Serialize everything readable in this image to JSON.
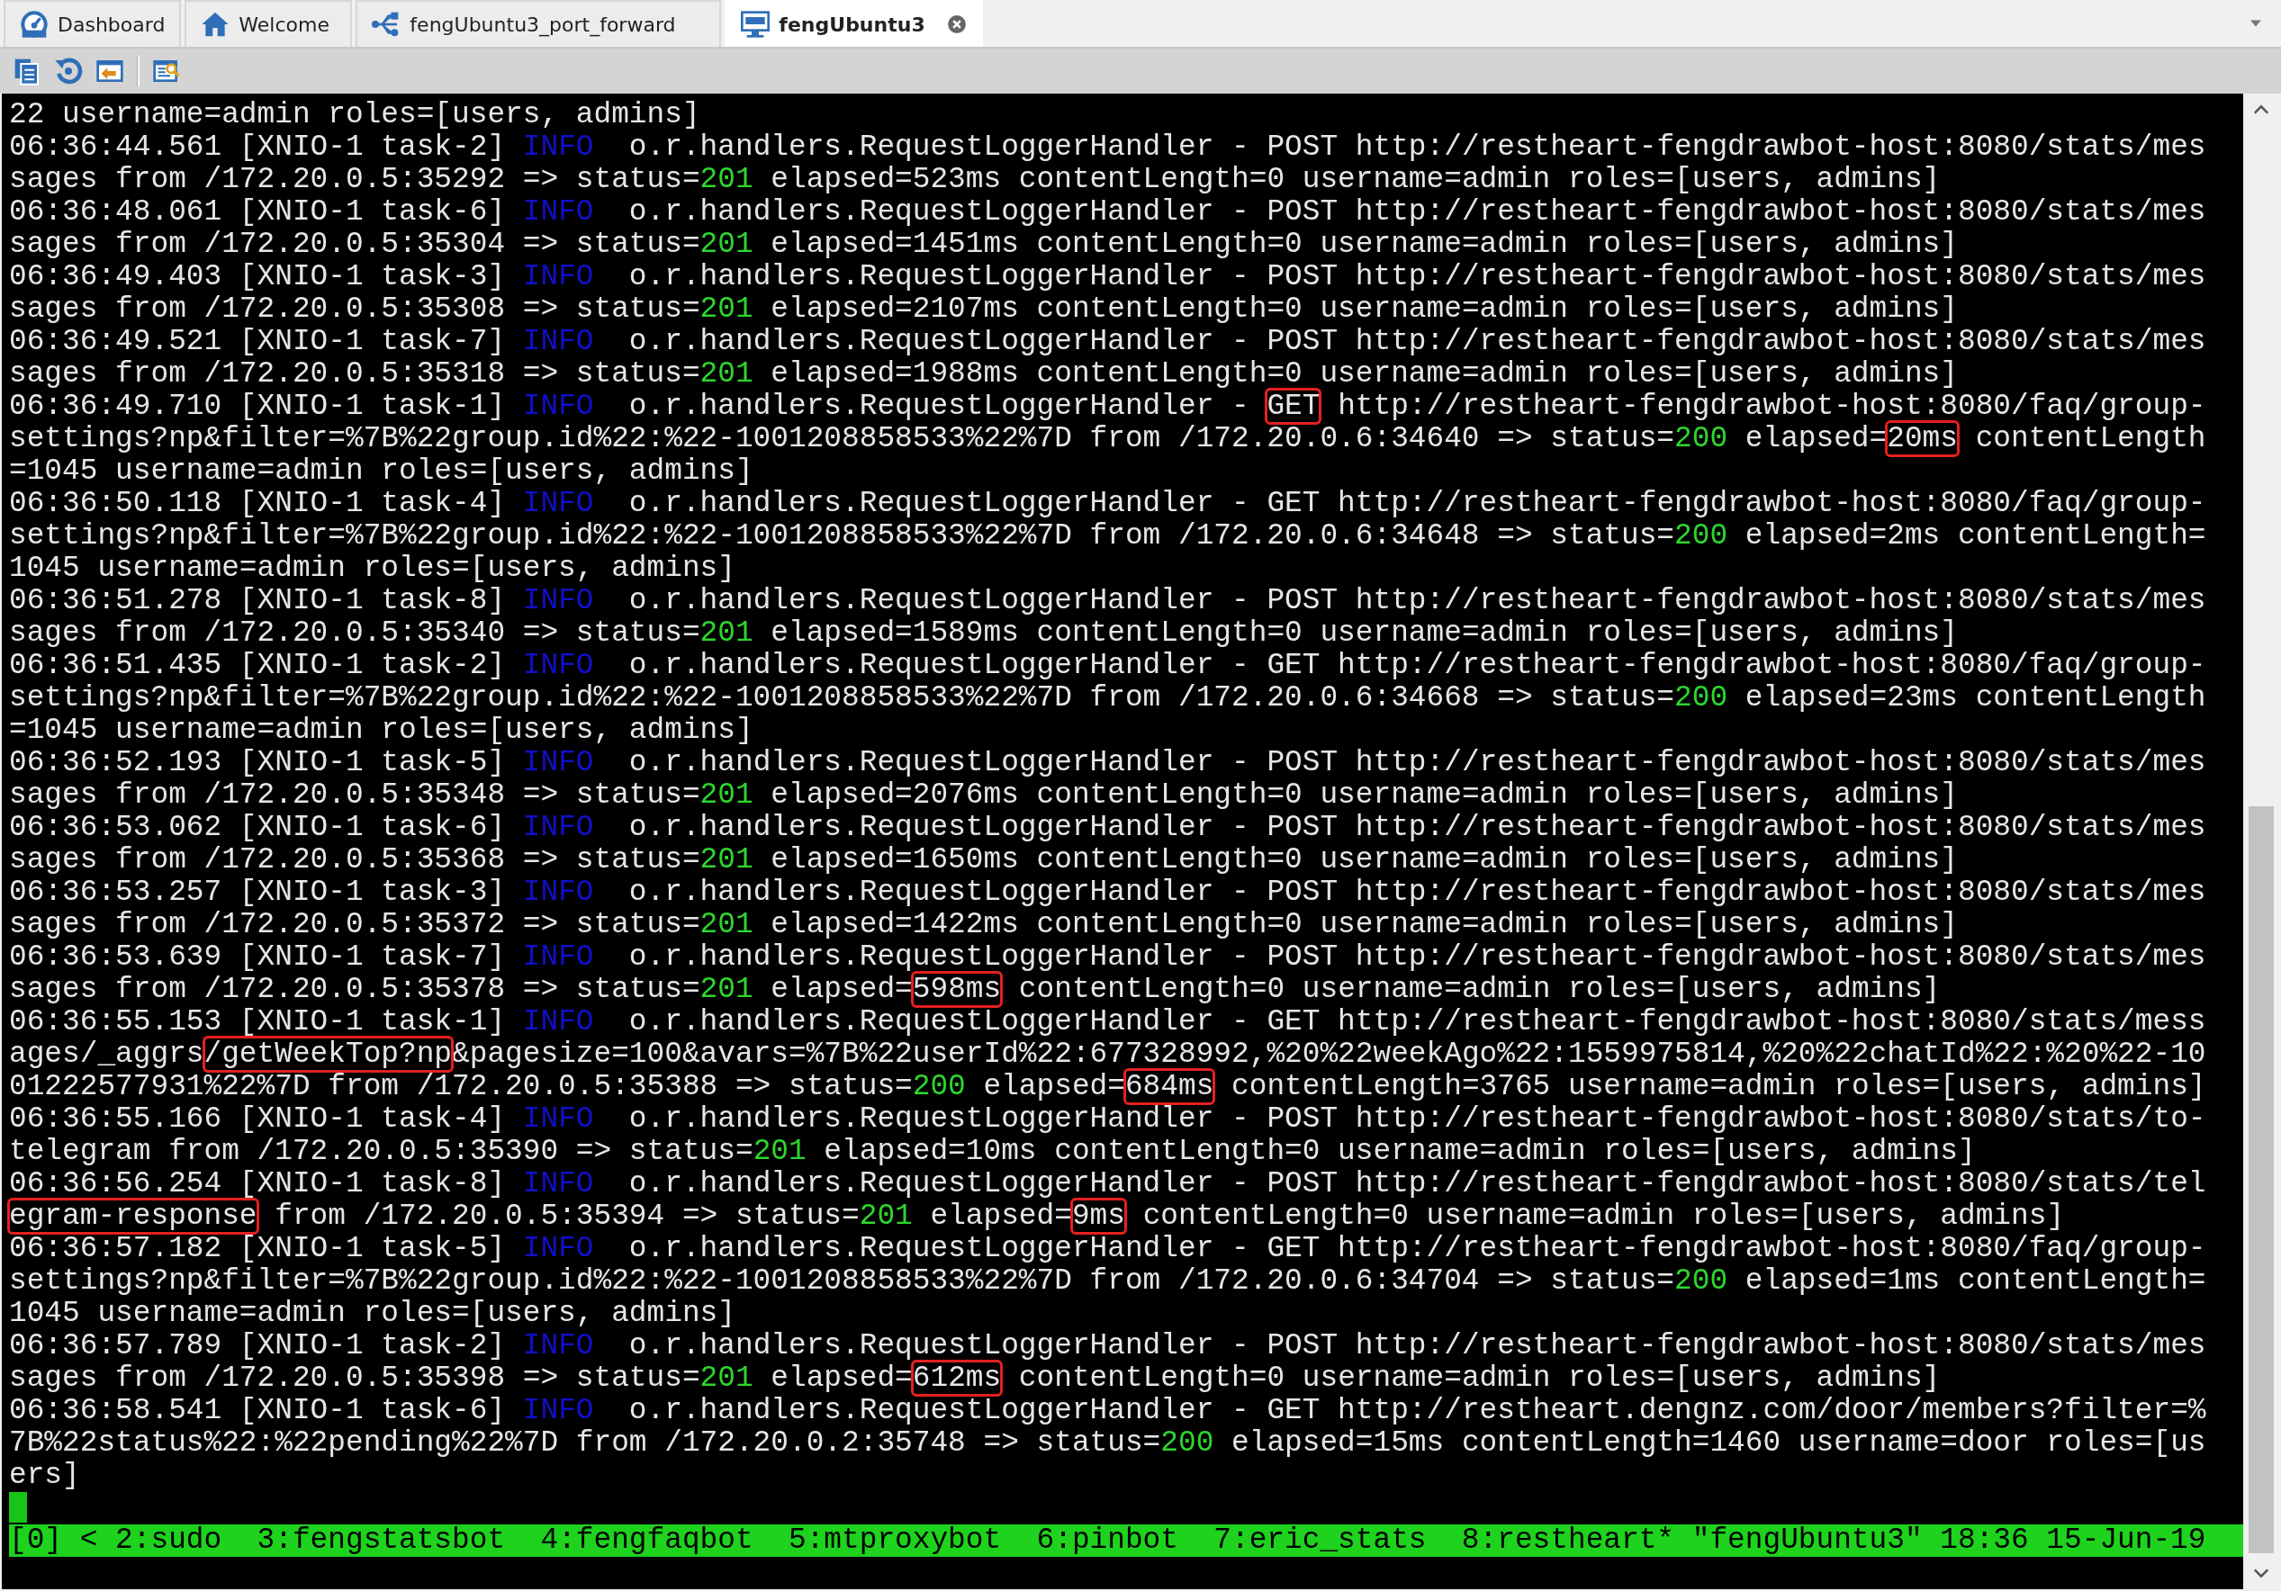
{
  "tabs": [
    {
      "label": "Dashboard",
      "kind": "dashboard",
      "selected": false
    },
    {
      "label": "Welcome",
      "kind": "welcome",
      "selected": false
    },
    {
      "label": "fengUbuntu3_port_forward",
      "kind": "forward",
      "selected": false
    },
    {
      "label": "fengUbuntu3",
      "kind": "ssh",
      "selected": true
    }
  ],
  "terminal": {
    "lines": [
      [
        {
          "text": "22 username=admin roles=[users, admins]",
          "kind": "text"
        }
      ],
      [
        {
          "text": "06:36:44.561 [XNIO-1 task-2] ",
          "kind": "text"
        },
        {
          "text": "INFO",
          "kind": "info"
        },
        {
          "text": "  o.r.handlers.RequestLoggerHandler - POST http://restheart-fengdrawbot-host:8080/stats/mes",
          "kind": "text"
        }
      ],
      [
        {
          "text": "sages from /172.20.0.5:35292 => status=",
          "kind": "text"
        },
        {
          "text": "201",
          "kind": "status"
        },
        {
          "text": " elapsed=523ms contentLength=0 username=admin roles=[users, admins]",
          "kind": "text"
        }
      ],
      [
        {
          "text": "06:36:48.061 [XNIO-1 task-6] ",
          "kind": "text"
        },
        {
          "text": "INFO",
          "kind": "info"
        },
        {
          "text": "  o.r.handlers.RequestLoggerHandler - POST http://restheart-fengdrawbot-host:8080/stats/mes",
          "kind": "text"
        }
      ],
      [
        {
          "text": "sages from /172.20.0.5:35304 => status=",
          "kind": "text"
        },
        {
          "text": "201",
          "kind": "status"
        },
        {
          "text": " elapsed=1451ms contentLength=0 username=admin roles=[users, admins]",
          "kind": "text"
        }
      ],
      [
        {
          "text": "06:36:49.403 [XNIO-1 task-3] ",
          "kind": "text"
        },
        {
          "text": "INFO",
          "kind": "info"
        },
        {
          "text": "  o.r.handlers.RequestLoggerHandler - POST http://restheart-fengdrawbot-host:8080/stats/mes",
          "kind": "text"
        }
      ],
      [
        {
          "text": "sages from /172.20.0.5:35308 => status=",
          "kind": "text"
        },
        {
          "text": "201",
          "kind": "status"
        },
        {
          "text": " elapsed=2107ms contentLength=0 username=admin roles=[users, admins]",
          "kind": "text"
        }
      ],
      [
        {
          "text": "06:36:49.521 [XNIO-1 task-7] ",
          "kind": "text"
        },
        {
          "text": "INFO",
          "kind": "info"
        },
        {
          "text": "  o.r.handlers.RequestLoggerHandler - POST http://restheart-fengdrawbot-host:8080/stats/mes",
          "kind": "text"
        }
      ],
      [
        {
          "text": "sages from /172.20.0.5:35318 => status=",
          "kind": "text"
        },
        {
          "text": "201",
          "kind": "status"
        },
        {
          "text": " elapsed=1988ms contentLength=0 username=admin roles=[users, admins]",
          "kind": "text"
        }
      ],
      [
        {
          "text": "06:36:49.710 [XNIO-1 task-1] ",
          "kind": "text"
        },
        {
          "text": "INFO",
          "kind": "info"
        },
        {
          "text": "  o.r.handlers.RequestLoggerHandler - ",
          "kind": "text"
        },
        {
          "text": "GET",
          "kind": "boxed"
        },
        {
          "text": " http://restheart-fengdrawbot-host:8080/faq/group-",
          "kind": "text"
        }
      ],
      [
        {
          "text": "settings?np&filter=%7B%22group.id%22:%22-1001208858533%22%7D from /172.20.0.6:34640 => status=",
          "kind": "text"
        },
        {
          "text": "200",
          "kind": "status"
        },
        {
          "text": " elapsed=",
          "kind": "text"
        },
        {
          "text": "20ms",
          "kind": "boxed"
        },
        {
          "text": " contentLength",
          "kind": "text"
        }
      ],
      [
        {
          "text": "=1045 username=admin roles=[users, admins]",
          "kind": "text"
        }
      ],
      [
        {
          "text": "06:36:50.118 [XNIO-1 task-4] ",
          "kind": "text"
        },
        {
          "text": "INFO",
          "kind": "info"
        },
        {
          "text": "  o.r.handlers.RequestLoggerHandler - GET http://restheart-fengdrawbot-host:8080/faq/group-",
          "kind": "text"
        }
      ],
      [
        {
          "text": "settings?np&filter=%7B%22group.id%22:%22-1001208858533%22%7D from /172.20.0.6:34648 => status=",
          "kind": "text"
        },
        {
          "text": "200",
          "kind": "status"
        },
        {
          "text": " elapsed=2ms contentLength=",
          "kind": "text"
        }
      ],
      [
        {
          "text": "1045 username=admin roles=[users, admins]",
          "kind": "text"
        }
      ],
      [
        {
          "text": "06:36:51.278 [XNIO-1 task-8] ",
          "kind": "text"
        },
        {
          "text": "INFO",
          "kind": "info"
        },
        {
          "text": "  o.r.handlers.RequestLoggerHandler - POST http://restheart-fengdrawbot-host:8080/stats/mes",
          "kind": "text"
        }
      ],
      [
        {
          "text": "sages from /172.20.0.5:35340 => status=",
          "kind": "text"
        },
        {
          "text": "201",
          "kind": "status"
        },
        {
          "text": " elapsed=1589ms contentLength=0 username=admin roles=[users, admins]",
          "kind": "text"
        }
      ],
      [
        {
          "text": "06:36:51.435 [XNIO-1 task-2] ",
          "kind": "text"
        },
        {
          "text": "INFO",
          "kind": "info"
        },
        {
          "text": "  o.r.handlers.RequestLoggerHandler - GET http://restheart-fengdrawbot-host:8080/faq/group-",
          "kind": "text"
        }
      ],
      [
        {
          "text": "settings?np&filter=%7B%22group.id%22:%22-1001208858533%22%7D from /172.20.0.6:34668 => status=",
          "kind": "text"
        },
        {
          "text": "200",
          "kind": "status"
        },
        {
          "text": " elapsed=23ms contentLength",
          "kind": "text"
        }
      ],
      [
        {
          "text": "=1045 username=admin roles=[users, admins]",
          "kind": "text"
        }
      ],
      [
        {
          "text": "06:36:52.193 [XNIO-1 task-5] ",
          "kind": "text"
        },
        {
          "text": "INFO",
          "kind": "info"
        },
        {
          "text": "  o.r.handlers.RequestLoggerHandler - POST http://restheart-fengdrawbot-host:8080/stats/mes",
          "kind": "text"
        }
      ],
      [
        {
          "text": "sages from /172.20.0.5:35348 => status=",
          "kind": "text"
        },
        {
          "text": "201",
          "kind": "status"
        },
        {
          "text": " elapsed=2076ms contentLength=0 username=admin roles=[users, admins]",
          "kind": "text"
        }
      ],
      [
        {
          "text": "06:36:53.062 [XNIO-1 task-6] ",
          "kind": "text"
        },
        {
          "text": "INFO",
          "kind": "info"
        },
        {
          "text": "  o.r.handlers.RequestLoggerHandler - POST http://restheart-fengdrawbot-host:8080/stats/mes",
          "kind": "text"
        }
      ],
      [
        {
          "text": "sages from /172.20.0.5:35368 => status=",
          "kind": "text"
        },
        {
          "text": "201",
          "kind": "status"
        },
        {
          "text": " elapsed=1650ms contentLength=0 username=admin roles=[users, admins]",
          "kind": "text"
        }
      ],
      [
        {
          "text": "06:36:53.257 [XNIO-1 task-3] ",
          "kind": "text"
        },
        {
          "text": "INFO",
          "kind": "info"
        },
        {
          "text": "  o.r.handlers.RequestLoggerHandler - POST http://restheart-fengdrawbot-host:8080/stats/mes",
          "kind": "text"
        }
      ],
      [
        {
          "text": "sages from /172.20.0.5:35372 => status=",
          "kind": "text"
        },
        {
          "text": "201",
          "kind": "status"
        },
        {
          "text": " elapsed=1422ms contentLength=0 username=admin roles=[users, admins]",
          "kind": "text"
        }
      ],
      [
        {
          "text": "06:36:53.639 [XNIO-1 task-7] ",
          "kind": "text"
        },
        {
          "text": "INFO",
          "kind": "info"
        },
        {
          "text": "  o.r.handlers.RequestLoggerHandler - POST http://restheart-fengdrawbot-host:8080/stats/mes",
          "kind": "text"
        }
      ],
      [
        {
          "text": "sages from /172.20.0.5:35378 => status=",
          "kind": "text"
        },
        {
          "text": "201",
          "kind": "status"
        },
        {
          "text": " elapsed=",
          "kind": "text"
        },
        {
          "text": "598ms",
          "kind": "boxed"
        },
        {
          "text": " contentLength=0 username=admin roles=[users, admins]",
          "kind": "text"
        }
      ],
      [
        {
          "text": "06:36:55.153 [XNIO-1 task-1] ",
          "kind": "text"
        },
        {
          "text": "INFO",
          "kind": "info"
        },
        {
          "text": "  o.r.handlers.RequestLoggerHandler - GET http://restheart-fengdrawbot-host:8080/stats/mess",
          "kind": "text"
        }
      ],
      [
        {
          "text": "ages/_aggrs",
          "kind": "text"
        },
        {
          "text": "/getWeekTop?np",
          "kind": "boxed"
        },
        {
          "text": "&pagesize=100&avars=%7B%22userId%22:677328992,%20%22weekAgo%22:1559975814,%20%22chatId%22:%20%22-10",
          "kind": "text"
        }
      ],
      [
        {
          "text": "01222577931%22%7D from /172.20.0.5:35388 => status=",
          "kind": "text"
        },
        {
          "text": "200",
          "kind": "status"
        },
        {
          "text": " elapsed=",
          "kind": "text"
        },
        {
          "text": "684ms",
          "kind": "boxed"
        },
        {
          "text": " contentLength=3765 username=admin roles=[users, admins]",
          "kind": "text"
        }
      ],
      [
        {
          "text": "06:36:55.166 [XNIO-1 task-4] ",
          "kind": "text"
        },
        {
          "text": "INFO",
          "kind": "info"
        },
        {
          "text": "  o.r.handlers.RequestLoggerHandler - POST http://restheart-fengdrawbot-host:8080/stats/to-",
          "kind": "text"
        }
      ],
      [
        {
          "text": "telegram from /172.20.0.5:35390 => status=",
          "kind": "text"
        },
        {
          "text": "201",
          "kind": "status"
        },
        {
          "text": " elapsed=10ms contentLength=0 username=admin roles=[users, admins]",
          "kind": "text"
        }
      ],
      [
        {
          "text": "06:36:56.254 [XNIO-1 task-8] ",
          "kind": "text"
        },
        {
          "text": "INFO",
          "kind": "info"
        },
        {
          "text": "  o.r.handlers.RequestLoggerHandler - POST http://restheart-fengdrawbot-host:8080/stats/tel",
          "kind": "text"
        }
      ],
      [
        {
          "text": "egram-response",
          "kind": "boxed"
        },
        {
          "text": " from /172.20.0.5:35394 => status=",
          "kind": "text"
        },
        {
          "text": "201",
          "kind": "status"
        },
        {
          "text": " elapsed=",
          "kind": "text"
        },
        {
          "text": "9ms",
          "kind": "boxed"
        },
        {
          "text": " contentLength=0 username=admin roles=[users, admins]",
          "kind": "text"
        }
      ],
      [
        {
          "text": "06:36:57.182 [XNIO-1 task-5] ",
          "kind": "text"
        },
        {
          "text": "INFO",
          "kind": "info"
        },
        {
          "text": "  o.r.handlers.RequestLoggerHandler - GET http://restheart-fengdrawbot-host:8080/faq/group-",
          "kind": "text"
        }
      ],
      [
        {
          "text": "settings?np&filter=%7B%22group.id%22:%22-1001208858533%22%7D from /172.20.0.6:34704 => status=",
          "kind": "text"
        },
        {
          "text": "200",
          "kind": "status"
        },
        {
          "text": " elapsed=1ms contentLength=",
          "kind": "text"
        }
      ],
      [
        {
          "text": "1045 username=admin roles=[users, admins]",
          "kind": "text"
        }
      ],
      [
        {
          "text": "06:36:57.789 [XNIO-1 task-2] ",
          "kind": "text"
        },
        {
          "text": "INFO",
          "kind": "info"
        },
        {
          "text": "  o.r.handlers.RequestLoggerHandler - POST http://restheart-fengdrawbot-host:8080/stats/mes",
          "kind": "text"
        }
      ],
      [
        {
          "text": "sages from /172.20.0.5:35398 => status=",
          "kind": "text"
        },
        {
          "text": "201",
          "kind": "status"
        },
        {
          "text": " elapsed=",
          "kind": "text"
        },
        {
          "text": "612ms",
          "kind": "boxed"
        },
        {
          "text": " contentLength=0 username=admin roles=[users, admins]",
          "kind": "text"
        }
      ],
      [
        {
          "text": "06:36:58.541 [XNIO-1 task-6] ",
          "kind": "text"
        },
        {
          "text": "INFO",
          "kind": "info"
        },
        {
          "text": "  o.r.handlers.RequestLoggerHandler - GET http://restheart.dengnz.com/door/members?filter=%",
          "kind": "text"
        }
      ],
      [
        {
          "text": "7B%22status%22:%22pending%22%7D from /172.20.0.2:35748 => status=",
          "kind": "text"
        },
        {
          "text": "200",
          "kind": "status"
        },
        {
          "text": " elapsed=15ms contentLength=1460 username=door roles=[us",
          "kind": "text"
        }
      ],
      [
        {
          "text": "ers]",
          "kind": "text"
        }
      ]
    ],
    "status_bar": "[0] < 2:sudo  3:fengstatsbot  4:fengfaqbot  5:mtproxybot  6:pinbot  7:eric_stats  8:restheart* \"fengUbuntu3\" 18:36 15-Jun-19"
  }
}
